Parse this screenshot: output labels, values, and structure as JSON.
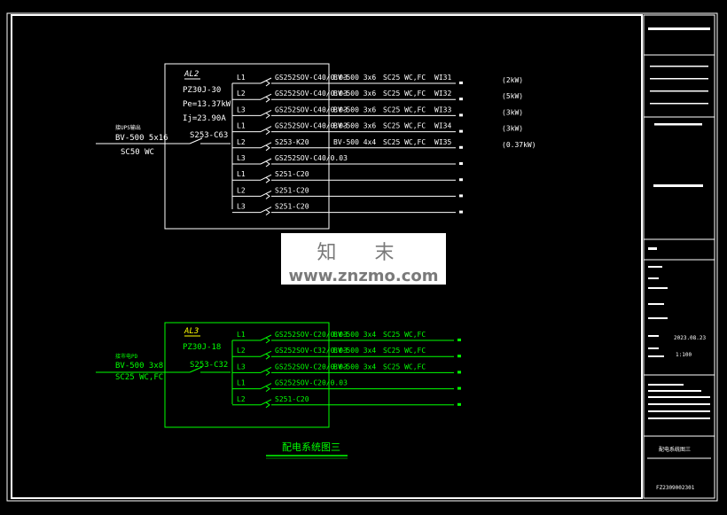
{
  "panel_al2": {
    "name": "AL2",
    "model": "PZ30J-30",
    "pe": "Pe=13.37kW",
    "ij": "Ij=23.90A",
    "main_switch": "S253-C63",
    "feed_label": "接UPS输出",
    "feed_cable": "BV-500 5x16",
    "feed_conduit": "SC50 WC",
    "circuits": [
      {
        "phase": "L1",
        "breaker": "GS252SOV-C40/0.03",
        "cable": "BV-500 3x6",
        "conduit": "SC25 WC,FC",
        "id": "WI31",
        "load": "(2kW)"
      },
      {
        "phase": "L2",
        "breaker": "GS252SOV-C40/0.03",
        "cable": "BV-500 3x6",
        "conduit": "SC25 WC,FC",
        "id": "WI32",
        "load": "(5kW)"
      },
      {
        "phase": "L3",
        "breaker": "GS252SOV-C40/0.03",
        "cable": "BV-500 3x6",
        "conduit": "SC25 WC,FC",
        "id": "WI33",
        "load": "(3kW)"
      },
      {
        "phase": "L1",
        "breaker": "GS252SOV-C40/0.03",
        "cable": "BV-500 3x6",
        "conduit": "SC25 WC,FC",
        "id": "WI34",
        "load": "(3kW)"
      },
      {
        "phase": "L2",
        "breaker": "S253-K20",
        "cable": "BV-500 4x4",
        "conduit": "SC25 WC,FC",
        "id": "WI35",
        "load": "(0.37kW)"
      },
      {
        "phase": "L3",
        "breaker": "GS252SOV-C40/0.03",
        "cable": "",
        "conduit": "",
        "id": "",
        "load": ""
      },
      {
        "phase": "L1",
        "breaker": "S251-C20",
        "cable": "",
        "conduit": "",
        "id": "",
        "load": ""
      },
      {
        "phase": "L2",
        "breaker": "S251-C20",
        "cable": "",
        "conduit": "",
        "id": "",
        "load": ""
      },
      {
        "phase": "L3",
        "breaker": "S251-C20",
        "cable": "",
        "conduit": "",
        "id": "",
        "load": ""
      }
    ]
  },
  "panel_al3": {
    "name": "AL3",
    "model": "PZ30J-18",
    "main_switch": "S253-C32",
    "feed_label": "接市电PD",
    "feed_cable": "BV-500 3x8",
    "feed_conduit": "SC25 WC,FC",
    "circuits": [
      {
        "phase": "L1",
        "breaker": "GS252SOV-C20/0.03",
        "cable": "BV-500 3x4",
        "conduit": "SC25 WC,FC"
      },
      {
        "phase": "L2",
        "breaker": "GS252SOV-C32/0.03",
        "cable": "BV-500 3x4",
        "conduit": "SC25 WC,FC"
      },
      {
        "phase": "L3",
        "breaker": "GS252SOV-C20/0.03",
        "cable": "BV-500 3x4",
        "conduit": "SC25 WC,FC"
      },
      {
        "phase": "L1",
        "breaker": "GS252SOV-C20/0.03",
        "cable": "",
        "conduit": ""
      },
      {
        "phase": "L2",
        "breaker": "S251-C20",
        "cable": "",
        "conduit": ""
      }
    ]
  },
  "drawing_caption": "配电系统图三",
  "title_block": {
    "date": "2023.08.23",
    "scale": "1:100",
    "sheet_title": "配电系统图三",
    "drawing_no": "FZ2309002301"
  },
  "watermark": {
    "cn": "知 末",
    "url": "www.znzmo.com"
  },
  "colors": {
    "white": "#ffffff",
    "green": "#00ff00",
    "yellow": "#ffff00",
    "background": "#000000"
  }
}
